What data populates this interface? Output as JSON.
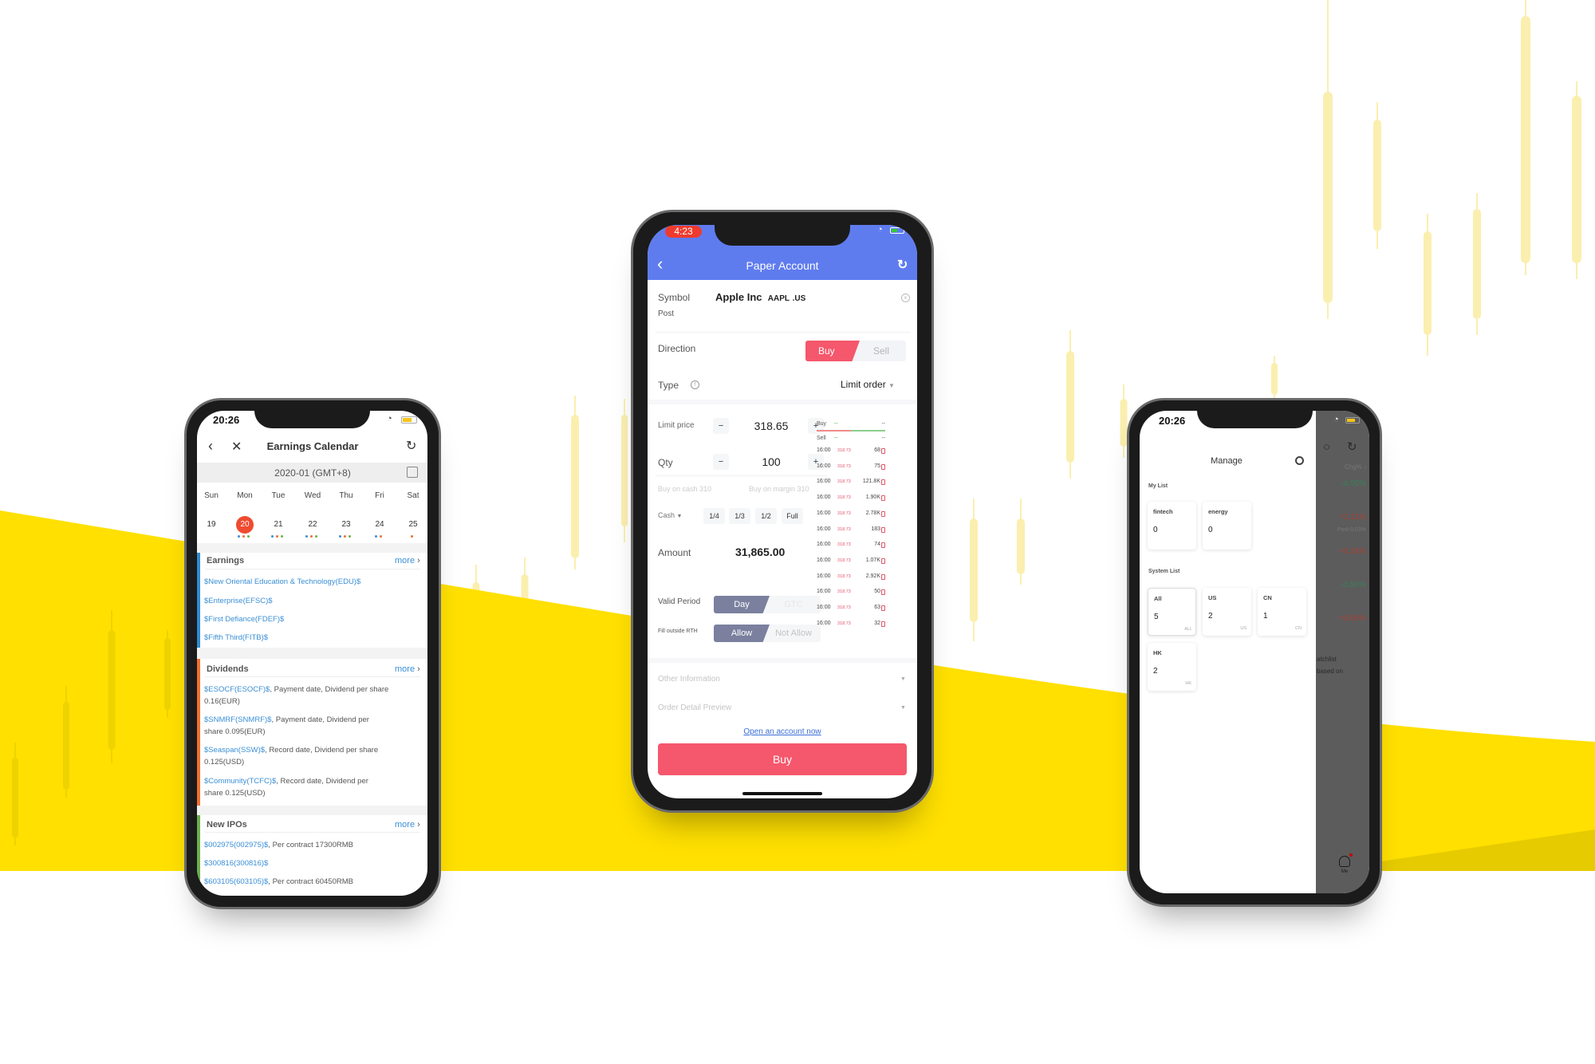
{
  "colors": {
    "yellow": "#FFE000",
    "header_blue": "#5F7CEF",
    "buy_red": "#F5576C",
    "toggle_slate": "#7A809E",
    "link_blue": "#3A8FD6",
    "gain_red": "#C0392B",
    "loss_green": "#2E8B57"
  },
  "trade": {
    "status_time": "4:23",
    "title": "Paper Account",
    "back_icon": "chevron-left-icon",
    "refresh_icon": "refresh-icon",
    "symbol_label": "Symbol",
    "symbol_name": "Apple Inc",
    "symbol_code": "AAPL",
    "symbol_market": ".US",
    "session": "Post",
    "direction_label": "Direction",
    "buy": "Buy",
    "sell": "Sell",
    "type_label": "Type",
    "type_value": "Limit order",
    "limit_label": "Limit price",
    "limit_value": "318.65",
    "qty_label": "Qty",
    "qty_value": "100",
    "buy_on_cash": "Buy on cash 310",
    "buy_on_margin": "Buy on margin 310",
    "cash_label": "Cash",
    "fractions": [
      "1/4",
      "1/3",
      "1/2",
      "Full"
    ],
    "amount_label": "Amount",
    "amount_value": "31,865.00",
    "valid_label": "Valid Period",
    "valid_day": "Day",
    "valid_gtc": "GTC",
    "rth_label": "Fill outside RTH",
    "rth_allow": "Allow",
    "rth_not": "Not Allow",
    "other_info": "Other Information",
    "order_preview": "Order Detail Preview",
    "open_account": "Open an account now",
    "buy_button": "Buy",
    "book": {
      "buy_label": "Buy",
      "sell_label": "Sell",
      "dash": "--",
      "dash2": "--",
      "ticks": [
        {
          "time": "16:00",
          "price": "318.73",
          "vol": "68"
        },
        {
          "time": "16:00",
          "price": "318.73",
          "vol": "75"
        },
        {
          "time": "16:00",
          "price": "318.73",
          "vol": "121.8K"
        },
        {
          "time": "16:00",
          "price": "318.73",
          "vol": "1.90K"
        },
        {
          "time": "16:00",
          "price": "318.73",
          "vol": "2.78K"
        },
        {
          "time": "16:00",
          "price": "318.73",
          "vol": "183"
        },
        {
          "time": "16:00",
          "price": "318.73",
          "vol": "74"
        },
        {
          "time": "16:00",
          "price": "318.73",
          "vol": "1.07K"
        },
        {
          "time": "16:00",
          "price": "318.73",
          "vol": "2.92K"
        },
        {
          "time": "16:00",
          "price": "318.73",
          "vol": "50"
        },
        {
          "time": "16:00",
          "price": "318.73",
          "vol": "63"
        },
        {
          "time": "16:00",
          "price": "318.73",
          "vol": "32"
        }
      ]
    }
  },
  "calendar": {
    "status_time": "20:26",
    "title": "Earnings Calendar",
    "month": "2020-01 (GMT+8)",
    "weekdays": [
      "Sun",
      "Mon",
      "Tue",
      "Wed",
      "Thu",
      "Fri",
      "Sat"
    ],
    "dates": [
      {
        "day": "19",
        "dots": []
      },
      {
        "day": "20",
        "dots": [
          "#3a8fd6",
          "#f07030",
          "#6ab04c"
        ],
        "selected": true
      },
      {
        "day": "21",
        "dots": [
          "#3a8fd6",
          "#f07030",
          "#6ab04c"
        ]
      },
      {
        "day": "22",
        "dots": [
          "#3a8fd6",
          "#f07030",
          "#6ab04c"
        ]
      },
      {
        "day": "23",
        "dots": [
          "#3a8fd6",
          "#f07030",
          "#6ab04c"
        ]
      },
      {
        "day": "24",
        "dots": [
          "#3a8fd6",
          "#f07030"
        ]
      },
      {
        "day": "25",
        "dots": [
          "#f07030"
        ]
      }
    ],
    "more": "more",
    "earnings": {
      "title": "Earnings",
      "items": [
        "$New Oriental Education & Technology(EDU)$",
        "$Enterprise(EFSC)$",
        "$First Defiance(FDEF)$",
        "$Fifth Third(FITB)$"
      ]
    },
    "dividends": {
      "title": "Dividends",
      "items": [
        {
          "link": "$ESOCF(ESOCF)$",
          "text": ",  Payment date,  Dividend per share",
          "text2": "0.16(EUR)"
        },
        {
          "link": "$SNMRF(SNMRF)$",
          "text": ",  Payment date,  Dividend per",
          "text2": "share 0.095(EUR)"
        },
        {
          "link": "$Seaspan(SSW)$",
          "text": ",  Record date,  Dividend per share",
          "text2": "0.125(USD)"
        },
        {
          "link": "$Community(TCFC)$",
          "text": ",  Record date,  Dividend per",
          "text2": "share 0.125(USD)"
        }
      ]
    },
    "ipos": {
      "title": "New IPOs",
      "items": [
        {
          "link": "$002975(002975)$",
          "text": ",  Per contract 17300RMB"
        },
        {
          "link": "$300816(300816)$",
          "text": ""
        },
        {
          "link": "$603105(603105)$",
          "text": ",  Per contract 60450RMB"
        }
      ]
    }
  },
  "watchlist": {
    "status_time": "20:26",
    "title": "Manage",
    "my_list_label": "My List",
    "my_lists": [
      {
        "name": "fintech",
        "count": "0"
      },
      {
        "name": "energy",
        "count": "0"
      }
    ],
    "system_list_label": "System List",
    "system_lists": [
      {
        "name": "All",
        "count": "5",
        "tag": "ALL"
      },
      {
        "name": "US",
        "count": "2",
        "tag": "US"
      },
      {
        "name": "CN",
        "count": "1",
        "tag": "CN"
      },
      {
        "name": "HK",
        "count": "2",
        "tag": "HK"
      }
    ],
    "behind": {
      "chg_label": "Chg% ↕",
      "changes": [
        "-4.05%",
        "+1.11%",
        "+0.34%",
        "-0.90%",
        "+0.66%"
      ],
      "post": "Post-0.03%",
      "text1": "atchlist",
      "text2": "based on",
      "me": "Me"
    }
  }
}
